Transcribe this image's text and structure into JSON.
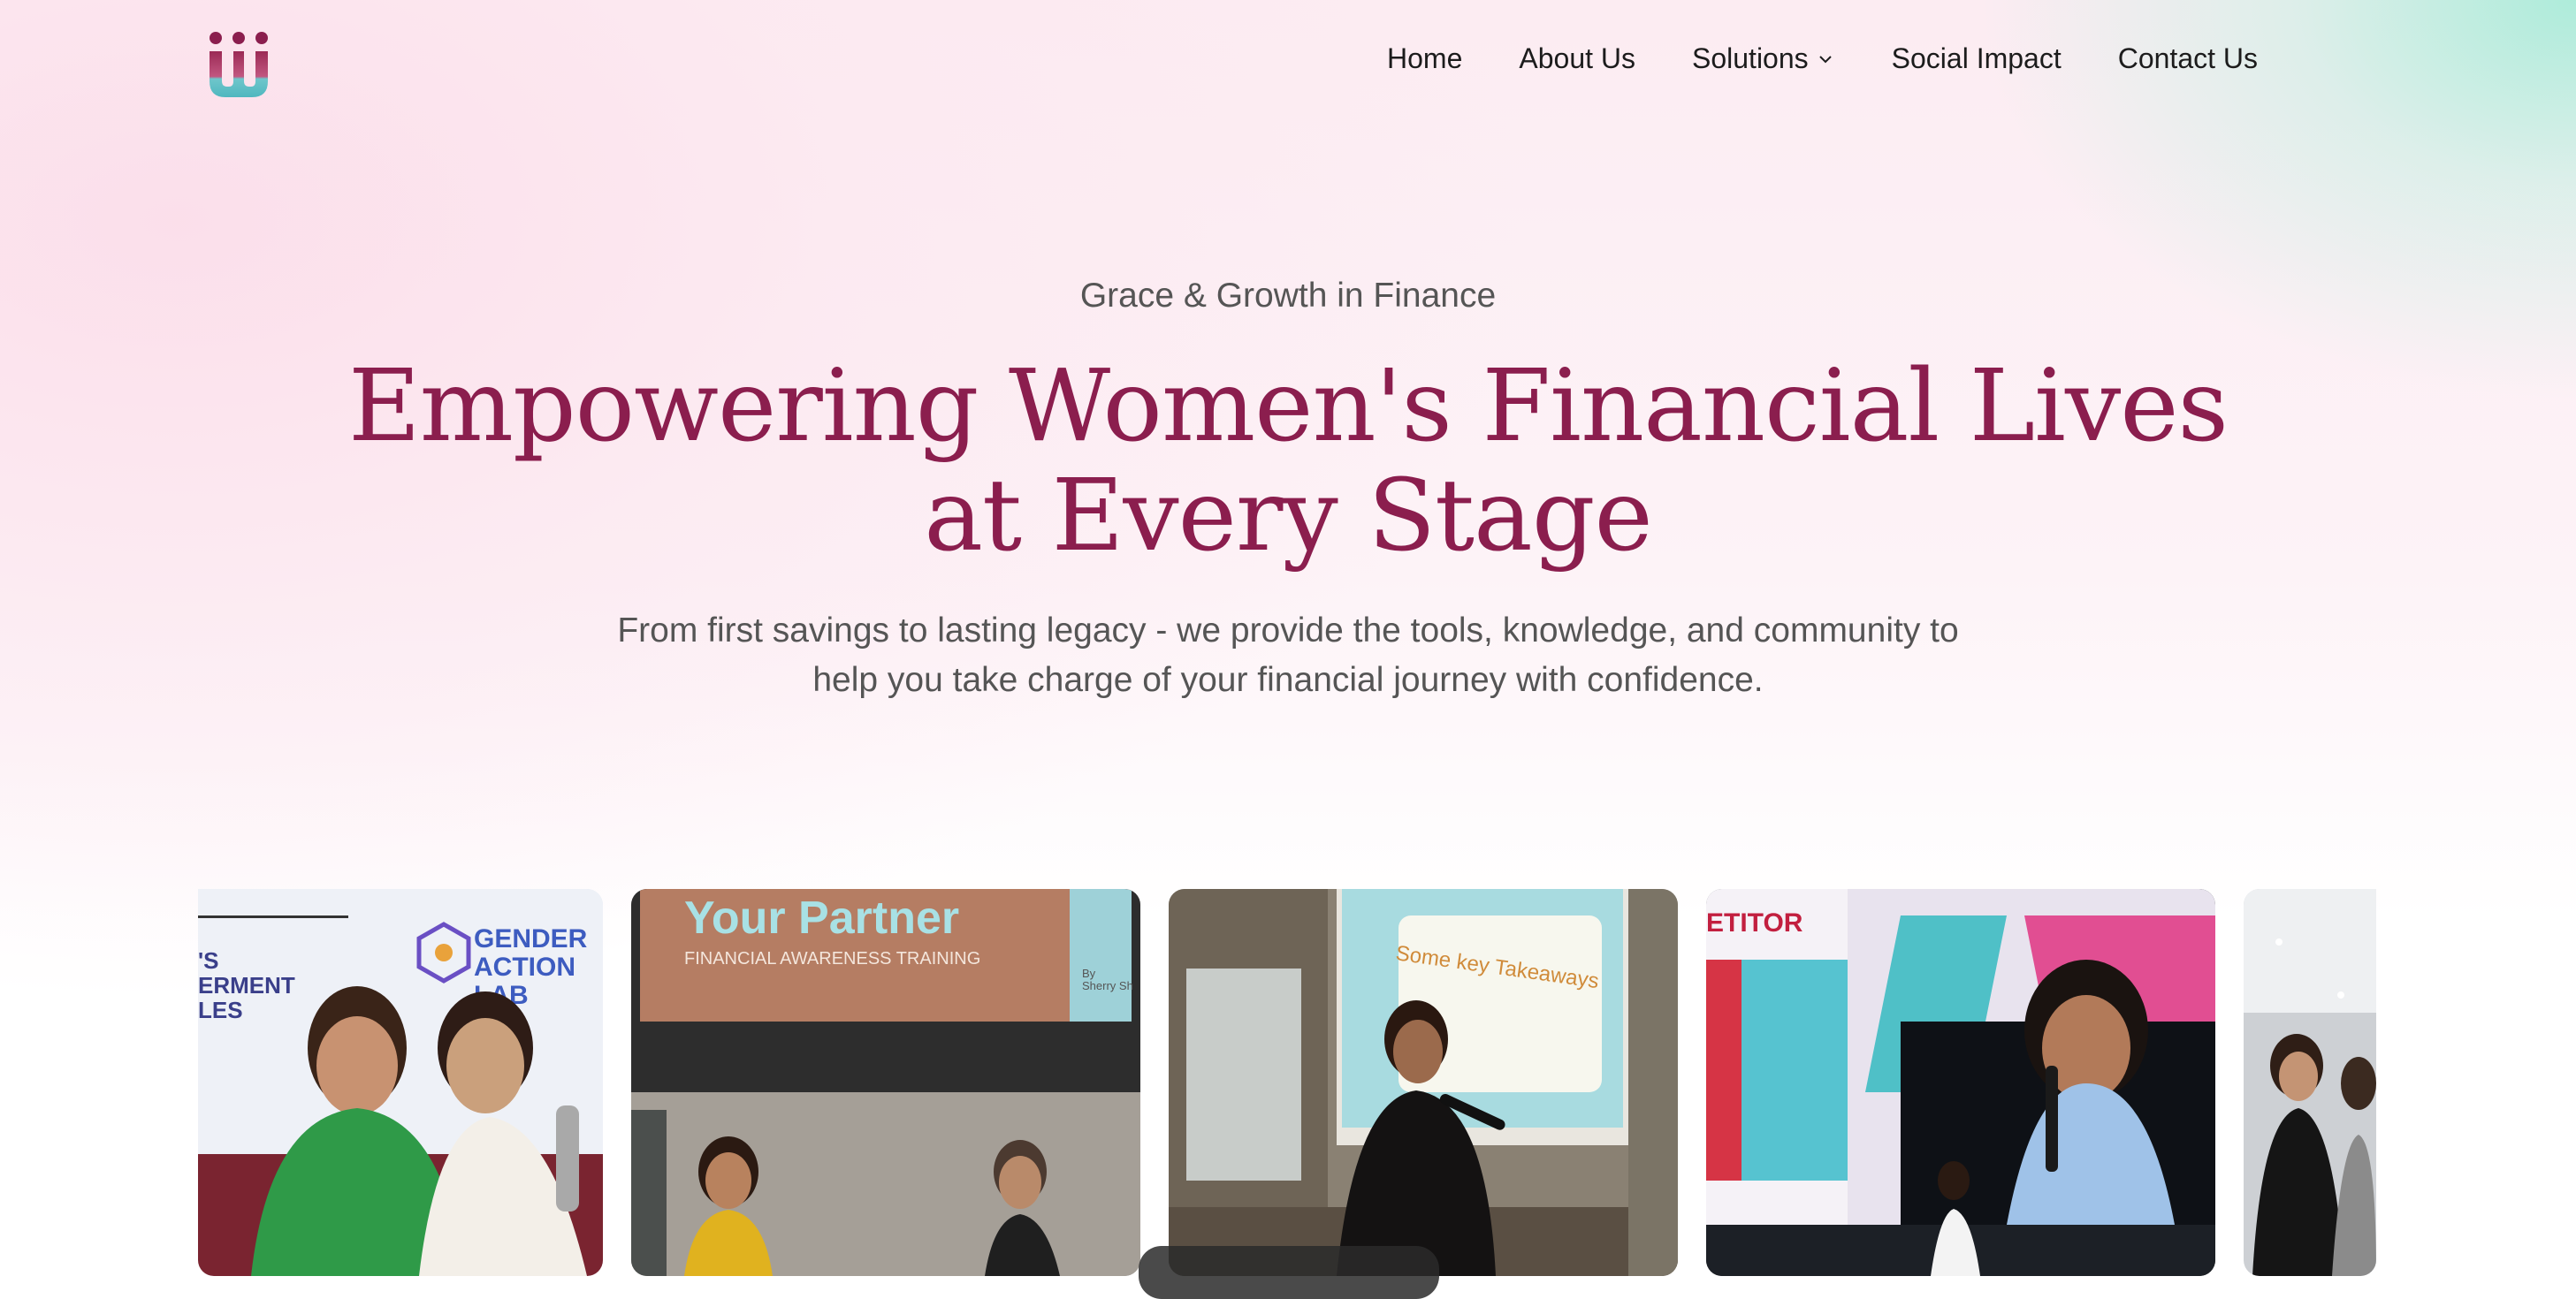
{
  "brand": {
    "logo_icon": "iii-logo-icon",
    "colors": {
      "primary": "#8b1e4e",
      "teal": "#5bc3c8",
      "text": "#555555"
    }
  },
  "nav": {
    "items": [
      {
        "label": "Home"
      },
      {
        "label": "About Us"
      },
      {
        "label": "Solutions",
        "icon": "chevron-down-icon"
      },
      {
        "label": "Social Impact"
      },
      {
        "label": "Contact Us"
      }
    ]
  },
  "hero": {
    "eyebrow": "Grace & Growth in Finance",
    "headline_line1": "Empowering Women's Financial Lives",
    "headline_line2": "at Every Stage",
    "subtext_line1": "From first savings to lasting legacy - we provide the tools, knowledge, and community to",
    "subtext_line2": "help you take charge of your financial journey with confidence."
  },
  "gallery": {
    "photos": [
      {
        "texts": [
          "'S",
          "ERMENT",
          "LES",
          "GENDER",
          "ACTION",
          "LAB"
        ]
      },
      {
        "texts": [
          "Your Partner",
          "FINANCIAL AWARENESS TRAINING",
          "By",
          "Sherry Sh"
        ]
      },
      {
        "texts": [
          "Some key Takeaways"
        ]
      },
      {
        "texts": [
          "ETITOR"
        ]
      },
      {
        "texts": []
      }
    ]
  }
}
